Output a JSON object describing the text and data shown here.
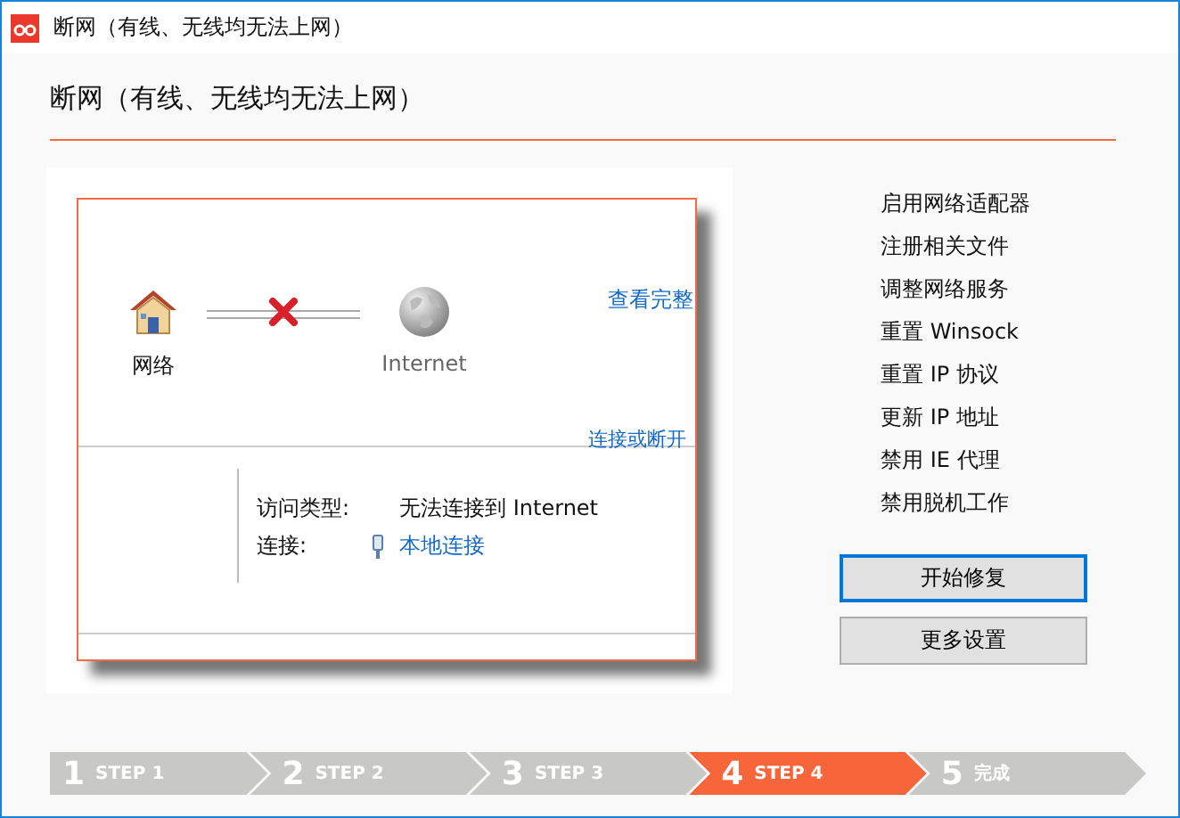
{
  "window": {
    "title": "断网（有线、无线均无法上网）"
  },
  "header": {
    "title": "断网（有线、无线均无法上网）"
  },
  "network_map": {
    "home_label": "网络",
    "internet_label": "Internet",
    "link_full_map": "查看完整",
    "link_connect": "连接或断开",
    "connected": false
  },
  "details": [
    {
      "label": "访问类型:",
      "value": "无法连接到 Internet",
      "kind": "text"
    },
    {
      "label": "连接:",
      "value": "本地连接",
      "kind": "link"
    }
  ],
  "repair_items": [
    "启用网络适配器",
    "注册相关文件",
    "调整网络服务",
    "重置 Winsock",
    "重置 IP 协议",
    "更新 IP 地址",
    "禁用 IE 代理",
    "禁用脱机工作"
  ],
  "buttons": [
    {
      "label": "开始修复",
      "focused": true
    },
    {
      "label": "更多设置",
      "focused": false
    }
  ],
  "steps": [
    {
      "number": "1",
      "label": "STEP 1",
      "selected": false
    },
    {
      "number": "2",
      "label": "STEP 2",
      "selected": false
    },
    {
      "number": "3",
      "label": "STEP 3",
      "selected": false
    },
    {
      "number": "4",
      "label": "STEP 4",
      "selected": true
    },
    {
      "number": "5",
      "label": "完成",
      "selected": false
    }
  ]
}
